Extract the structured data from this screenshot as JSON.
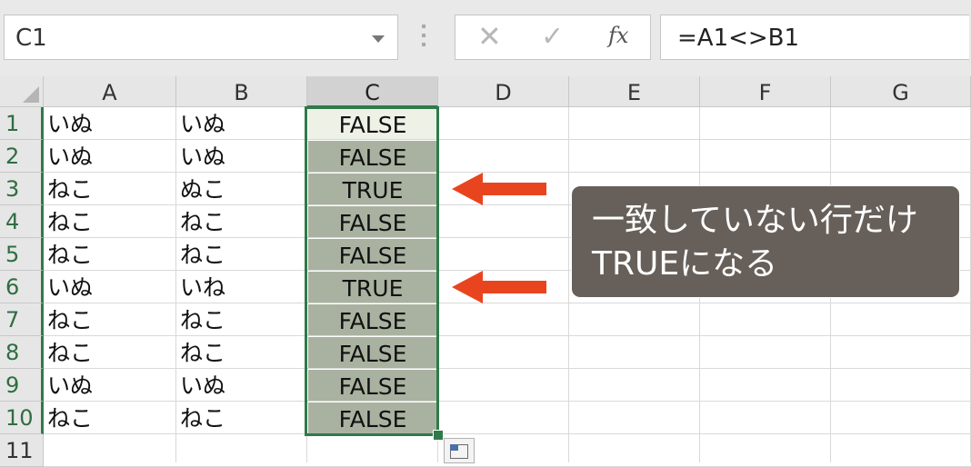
{
  "formula_bar": {
    "name_box": "C1",
    "cancel_glyph": "✕",
    "enter_glyph": "✓",
    "function_glyph": "fx",
    "formula": "=A1<>B1"
  },
  "sheet": {
    "columns": [
      "A",
      "B",
      "C",
      "D",
      "E",
      "F",
      "G"
    ],
    "rows": [
      "1",
      "2",
      "3",
      "4",
      "5",
      "6",
      "7",
      "8",
      "9",
      "10",
      "11"
    ],
    "col_a": [
      "いぬ",
      "いぬ",
      "ねこ",
      "ねこ",
      "ねこ",
      "いぬ",
      "ねこ",
      "ねこ",
      "いぬ",
      "ねこ"
    ],
    "col_b": [
      "いぬ",
      "いぬ",
      "ぬこ",
      "ねこ",
      "ねこ",
      "いね",
      "ねこ",
      "ねこ",
      "いぬ",
      "ねこ"
    ],
    "col_c": [
      "FALSE",
      "FALSE",
      "TRUE",
      "FALSE",
      "FALSE",
      "TRUE",
      "FALSE",
      "FALSE",
      "FALSE",
      "FALSE"
    ],
    "selected_column": "C",
    "active_cell": "C1"
  },
  "annotation": {
    "line1": "一致していない行だけ",
    "line2": "TRUEになる",
    "arrow_color": "#e8451f",
    "callout_color": "#67605a"
  },
  "colors": {
    "selection": "#2f7a4a",
    "selected_fill": "#a9b2a0"
  }
}
